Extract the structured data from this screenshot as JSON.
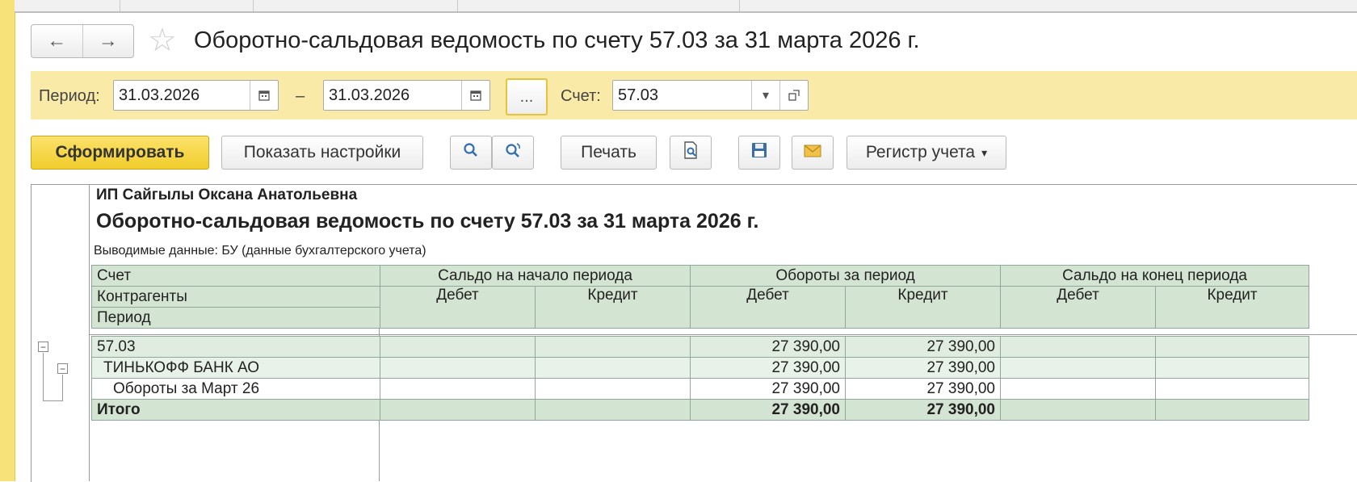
{
  "window": {
    "title": "Оборотно-сальдовая ведомость по счету 57.03 за 31 марта 2026 г."
  },
  "nav": {
    "back_icon": "←",
    "forward_icon": "→",
    "favorite_icon": "☆"
  },
  "filter": {
    "period_label": "Период:",
    "date_from": "31.03.2026",
    "dash": "–",
    "date_to": "31.03.2026",
    "dots_label": "...",
    "account_label": "Счет:",
    "account_value": "57.03"
  },
  "toolbar": {
    "generate": "Сформировать",
    "show_settings": "Показать настройки",
    "print": "Печать",
    "ledger": "Регистр учета"
  },
  "report": {
    "org": "ИП Сайгылы Оксана Анатольевна",
    "title": "Оборотно-сальдовая ведомость по счету 57.03 за 31 марта 2026 г.",
    "output_note": "Выводимые данные:  БУ (данные бухгалтерского учета)",
    "headers": {
      "account": "Счет",
      "counterparties": "Контрагенты",
      "period": "Период",
      "opening": "Сальдо на начало периода",
      "turnover": "Обороты за период",
      "closing": "Сальдо на конец периода",
      "debit": "Дебет",
      "credit": "Кредит"
    },
    "rows": [
      {
        "name": "57.03",
        "open_debit": "",
        "open_credit": "",
        "turn_debit": "27 390,00",
        "turn_credit": "27 390,00",
        "close_debit": "",
        "close_credit": ""
      },
      {
        "name": "ТИНЬКОФФ БАНК АО",
        "open_debit": "",
        "open_credit": "",
        "turn_debit": "27 390,00",
        "turn_credit": "27 390,00",
        "close_debit": "",
        "close_credit": ""
      },
      {
        "name": "Обороты за Март 26",
        "open_debit": "",
        "open_credit": "",
        "turn_debit": "27 390,00",
        "turn_credit": "27 390,00",
        "close_debit": "",
        "close_credit": ""
      }
    ],
    "total": {
      "name": "Итого",
      "turn_debit": "27 390,00",
      "turn_credit": "27 390,00"
    }
  }
}
